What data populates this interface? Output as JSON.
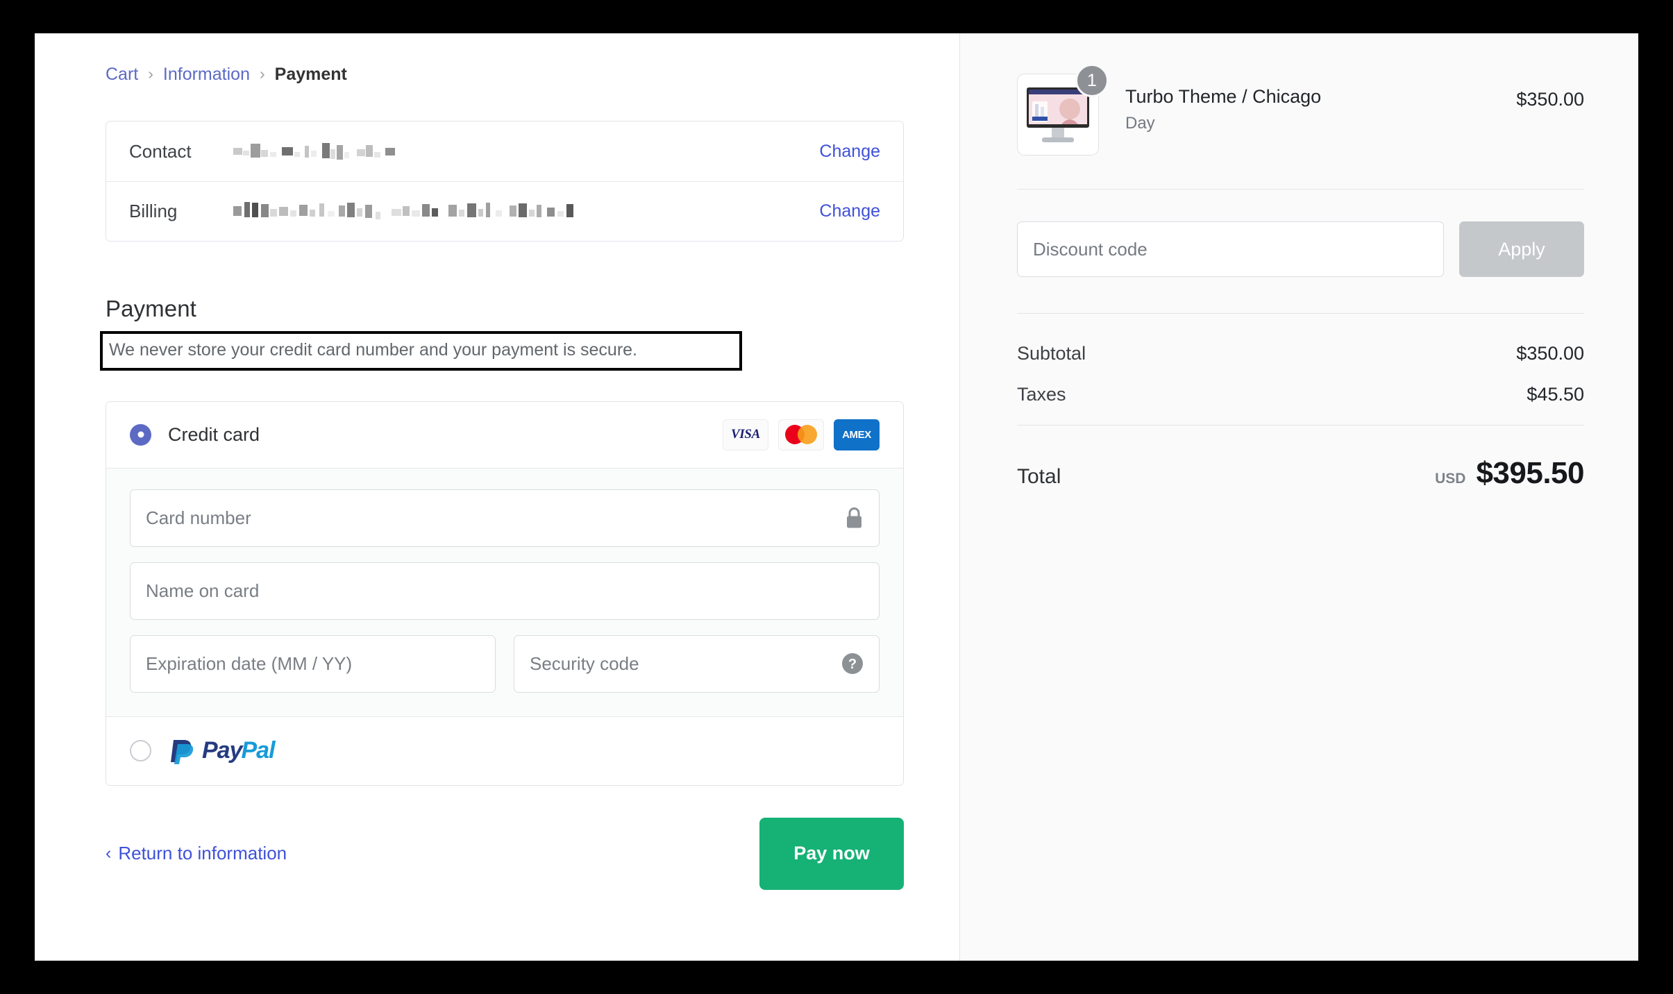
{
  "breadcrumb": {
    "items": [
      {
        "label": "Cart",
        "current": false
      },
      {
        "label": "Information",
        "current": false
      },
      {
        "label": "Payment",
        "current": true
      }
    ],
    "separator": "›"
  },
  "review": {
    "rows": [
      {
        "label": "Contact",
        "value": "",
        "value_redacted": true,
        "action": "Change"
      },
      {
        "label": "Billing",
        "value": "",
        "value_redacted": true,
        "action": "Change"
      }
    ]
  },
  "payment": {
    "heading": "Payment",
    "secure_note": "We never store your credit card number and your payment is secure.",
    "methods": [
      {
        "id": "credit-card",
        "label": "Credit card",
        "selected": true,
        "brands": [
          "VISA",
          "mastercard",
          "AMEX"
        ]
      },
      {
        "id": "paypal",
        "label": "PayPal",
        "selected": false,
        "logo_parts": [
          "Pay",
          "Pal"
        ]
      }
    ],
    "fields": {
      "card_number": {
        "placeholder": "Card number",
        "value": "",
        "icon": "lock-icon"
      },
      "name_on_card": {
        "placeholder": "Name on card",
        "value": ""
      },
      "expiration": {
        "placeholder": "Expiration date (MM / YY)",
        "value": ""
      },
      "security_code": {
        "placeholder": "Security code",
        "value": "",
        "icon": "help-icon"
      }
    }
  },
  "actions": {
    "return_chevron": "‹",
    "return_label": "Return to information",
    "pay_label": "Pay now"
  },
  "summary": {
    "line_items": [
      {
        "title": "Turbo Theme / Chicago",
        "variant": "Day",
        "price": "$350.00",
        "quantity": "1"
      }
    ],
    "discount": {
      "placeholder": "Discount code",
      "value": "",
      "apply_label": "Apply"
    },
    "totals": [
      {
        "label": "Subtotal",
        "value": "$350.00"
      },
      {
        "label": "Taxes",
        "value": "$45.50"
      }
    ],
    "grand_total": {
      "label": "Total",
      "currency": "USD",
      "value": "$395.50"
    }
  },
  "colors": {
    "link": "#5c6ac4",
    "link_alt": "#3f51d8",
    "pay_button": "#16b175",
    "radio_selected": "#5c6ac4",
    "apply_disabled": "#c5c8cb",
    "amex_blue": "#1071c8",
    "visa_navy": "#1a1f71",
    "mc_red": "#eb001b",
    "mc_yellow": "#f79e1b",
    "paypal_dark": "#253b80",
    "paypal_light": "#179bd7"
  }
}
